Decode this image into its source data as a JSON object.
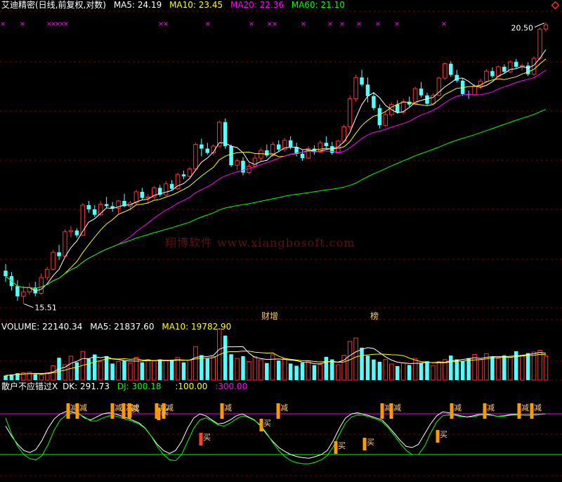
{
  "price_panel": {
    "title": "艾迪精密(日线,前复权,对数)",
    "ma_labels": [
      {
        "text": "MA5: 24.19",
        "color": "#ffffff"
      },
      {
        "text": "MA10: 23.45",
        "color": "#ffff00"
      },
      {
        "text": "MA20: 22.36",
        "color": "#ff00ff"
      },
      {
        "text": "MA60: 21.10",
        "color": "#00ff00"
      }
    ],
    "high_label": "20.50",
    "low_label": "15.51",
    "event_labels": [
      "财增",
      "榜"
    ],
    "watermark": "翔博软件 www.xiangbosoft.com"
  },
  "volume_panel": {
    "labels": [
      {
        "text": "VOLUME: 22140.34",
        "color": "#ffffff"
      },
      {
        "text": "MA5: 21837.60",
        "color": "#ffffff"
      },
      {
        "text": "MA10: 19782.90",
        "color": "#ffff00"
      }
    ]
  },
  "indicator_panel": {
    "labels": [
      {
        "text": "散户不应错过X",
        "color": "#ffffff"
      },
      {
        "text": "DK: 291.73",
        "color": "#ffffff"
      },
      {
        "text": "DJ: 300.18",
        "color": "#00ff00"
      },
      {
        "text": ":100.00",
        "color": "#ffff00"
      },
      {
        "text": ":300.00",
        "color": "#ff00ff"
      }
    ],
    "sell_label": "减",
    "buy_label": "买"
  },
  "colors": {
    "up": "#ff3232",
    "down": "#54ffff",
    "ma5": "#ffffff",
    "ma10": "#ffff00",
    "ma20": "#ff00ff",
    "ma60": "#00ff00",
    "grid": "#7a0000",
    "marker": "#ff00ff",
    "signal": "#ff9900"
  },
  "chart_data": [
    {
      "type": "candlestick",
      "series_order": [
        "open",
        "high",
        "low",
        "close"
      ],
      "candles": [
        [
          19.0,
          19.5,
          18.2,
          18.6
        ],
        [
          18.6,
          18.9,
          17.6,
          17.9
        ],
        [
          17.9,
          18.3,
          16.9,
          17.2
        ],
        [
          17.2,
          17.9,
          16.7,
          17.5
        ],
        [
          17.5,
          18.1,
          17.3,
          17.8
        ],
        [
          17.8,
          18.2,
          17.2,
          17.4
        ],
        [
          17.4,
          18.8,
          17.3,
          18.5
        ],
        [
          18.5,
          19.3,
          18.3,
          19.1
        ],
        [
          19.1,
          20.6,
          19.0,
          20.4
        ],
        [
          20.4,
          21.0,
          19.8,
          20.1
        ],
        [
          20.1,
          22.3,
          20.0,
          22.1
        ],
        [
          22.1,
          22.6,
          21.6,
          22.2
        ],
        [
          22.2,
          22.4,
          21.6,
          21.8
        ],
        [
          21.8,
          24.7,
          21.7,
          24.5
        ],
        [
          24.5,
          24.9,
          23.8,
          24.1
        ],
        [
          24.1,
          24.5,
          23.4,
          23.6
        ],
        [
          23.6,
          24.9,
          23.5,
          24.6
        ],
        [
          24.6,
          25.3,
          24.2,
          24.4
        ],
        [
          24.4,
          24.8,
          23.9,
          24.2
        ],
        [
          24.2,
          25.0,
          23.7,
          24.9
        ],
        [
          24.9,
          25.6,
          24.3,
          24.4
        ],
        [
          24.4,
          24.9,
          24.0,
          24.7
        ],
        [
          24.7,
          26.0,
          24.5,
          25.8
        ],
        [
          25.8,
          26.2,
          25.0,
          25.2
        ],
        [
          25.2,
          25.6,
          24.6,
          25.3
        ],
        [
          25.3,
          26.4,
          25.1,
          26.2
        ],
        [
          26.2,
          26.5,
          25.3,
          25.5
        ],
        [
          25.5,
          26.9,
          25.4,
          26.6
        ],
        [
          26.6,
          27.0,
          25.9,
          26.1
        ],
        [
          26.1,
          27.8,
          26.0,
          27.6
        ],
        [
          27.6,
          28.0,
          27.1,
          27.4
        ],
        [
          27.4,
          28.4,
          27.3,
          28.2
        ],
        [
          28.2,
          31.2,
          28.0,
          31.0
        ],
        [
          31.0,
          31.7,
          29.6,
          30.5
        ],
        [
          30.5,
          31.2,
          29.8,
          30.0
        ],
        [
          30.0,
          31.0,
          29.7,
          30.8
        ],
        [
          30.8,
          34.0,
          30.6,
          33.8
        ],
        [
          33.8,
          34.3,
          30.5,
          30.8
        ],
        [
          30.8,
          31.0,
          28.4,
          28.6
        ],
        [
          28.6,
          29.3,
          28.1,
          29.1
        ],
        [
          29.1,
          29.5,
          27.5,
          27.8
        ],
        [
          27.8,
          28.8,
          27.6,
          28.5
        ],
        [
          28.5,
          29.8,
          28.3,
          29.4
        ],
        [
          29.4,
          30.6,
          29.0,
          30.3
        ],
        [
          30.3,
          31.0,
          29.5,
          29.7
        ],
        [
          29.7,
          31.3,
          29.5,
          31.0
        ],
        [
          31.0,
          31.5,
          30.2,
          30.4
        ],
        [
          30.4,
          31.8,
          30.1,
          31.5
        ],
        [
          31.5,
          32.0,
          30.4,
          30.7
        ],
        [
          30.7,
          31.2,
          29.6,
          29.9
        ],
        [
          29.9,
          30.3,
          29.1,
          29.4
        ],
        [
          29.4,
          30.8,
          29.3,
          30.5
        ],
        [
          30.5,
          30.9,
          29.8,
          30.1
        ],
        [
          30.1,
          31.5,
          30.0,
          31.2
        ],
        [
          31.2,
          32.0,
          30.5,
          30.8
        ],
        [
          30.8,
          31.3,
          29.8,
          30.0
        ],
        [
          30.0,
          31.6,
          29.9,
          31.4
        ],
        [
          31.4,
          33.5,
          31.2,
          33.2
        ],
        [
          33.2,
          37.5,
          32.8,
          37.0
        ],
        [
          37.0,
          40.6,
          36.6,
          40.2
        ],
        [
          40.2,
          41.4,
          38.8,
          39.1
        ],
        [
          39.1,
          40.2,
          36.5,
          37.4
        ],
        [
          37.4,
          38.0,
          35.4,
          35.7
        ],
        [
          35.7,
          36.2,
          33.0,
          33.4
        ],
        [
          33.4,
          35.1,
          33.2,
          34.8
        ],
        [
          34.8,
          36.5,
          34.5,
          36.2
        ],
        [
          36.2,
          36.8,
          34.9,
          35.1
        ],
        [
          35.1,
          37.0,
          34.9,
          36.6
        ],
        [
          36.6,
          37.3,
          35.9,
          36.2
        ],
        [
          36.2,
          38.8,
          36.1,
          38.5
        ],
        [
          38.5,
          39.5,
          37.2,
          37.5
        ],
        [
          37.5,
          37.9,
          36.1,
          36.3
        ],
        [
          36.3,
          37.8,
          36.2,
          37.5
        ],
        [
          37.5,
          40.3,
          37.4,
          40.1
        ],
        [
          40.1,
          42.6,
          39.8,
          42.4
        ],
        [
          42.4,
          42.8,
          40.3,
          40.6
        ],
        [
          40.6,
          41.4,
          39.4,
          39.7
        ],
        [
          39.7,
          40.0,
          37.4,
          37.7
        ],
        [
          37.7,
          38.2,
          37.0,
          37.6
        ],
        [
          37.6,
          39.2,
          37.4,
          38.9
        ],
        [
          38.9,
          40.0,
          38.4,
          39.6
        ],
        [
          39.6,
          41.5,
          39.4,
          41.2
        ],
        [
          41.2,
          41.8,
          40.1,
          40.4
        ],
        [
          40.4,
          42.1,
          40.2,
          41.9
        ],
        [
          41.9,
          42.3,
          40.8,
          41.1
        ],
        [
          41.1,
          43.0,
          40.9,
          42.7
        ],
        [
          42.7,
          43.2,
          41.6,
          41.9
        ],
        [
          41.9,
          42.4,
          41.3,
          42.1
        ],
        [
          42.1,
          42.6,
          40.4,
          40.7
        ],
        [
          40.7,
          43.6,
          40.5,
          43.3
        ],
        [
          43.3,
          48.8,
          43.0,
          48.5
        ],
        [
          48.5,
          49.8,
          48.0,
          49.3
        ]
      ]
    },
    {
      "type": "bar",
      "name": "VOLUME",
      "values": [
        4200,
        5100,
        6300,
        6800,
        7200,
        5300,
        4800,
        6900,
        13200,
        20400,
        14100,
        21800,
        16300,
        26200,
        19400,
        23400,
        16800,
        21900,
        15100,
        17200,
        17700,
        15600,
        20800,
        16200,
        18800,
        17400,
        18900,
        18300,
        17800,
        20600,
        16100,
        18300,
        30600,
        22800,
        19600,
        21400,
        46800,
        40600,
        23600,
        19800,
        21900,
        16900,
        21400,
        18600,
        15600,
        23100,
        17800,
        19600,
        15100,
        13100,
        15800,
        17200,
        13700,
        14300,
        21200,
        18900,
        14100,
        22600,
        35300,
        38400,
        29600,
        22300,
        18800,
        16700,
        18800,
        14700,
        12800,
        15600,
        13800,
        19800,
        15400,
        17200,
        13400,
        16800,
        18700,
        22400,
        18900,
        17600,
        20100,
        23400,
        18600,
        24100,
        21300,
        19800,
        22600,
        20900,
        26400,
        22700,
        24600,
        25600,
        27200,
        22100
      ]
    },
    {
      "type": "line",
      "name": "散户不应错过X",
      "ylim": [
        0,
        400
      ],
      "reference_lines": [
        100,
        300
      ],
      "sell_signals": [
        22,
        27,
        38,
        54,
        70,
        73,
        85,
        88,
        100,
        118,
        130,
        153,
        167,
        173,
        182,
        188
      ],
      "buy_signals": [
        70,
        140,
        183,
        240,
        253,
        308
      ],
      "series": [
        {
          "name": "DK",
          "values": [
            240,
            190,
            150,
            120,
            110,
            125,
            170,
            230,
            275,
            300,
            312,
            310,
            302,
            280,
            270,
            285,
            300,
            305,
            300,
            290,
            280,
            268,
            255,
            230,
            190,
            150,
            120,
            105,
            120,
            165,
            230,
            280,
            300,
            290,
            270,
            250,
            255,
            270,
            290,
            300,
            285,
            270,
            240,
            200,
            165,
            135,
            115,
            100,
            90,
            85,
            82,
            90,
            100,
            120,
            170,
            230,
            280,
            300,
            305,
            298,
            290,
            280,
            270,
            240,
            205,
            170,
            140,
            135,
            150,
            200,
            250,
            290,
            310,
            305,
            298,
            290,
            285,
            290,
            298,
            300,
            295,
            288,
            290,
            296,
            298,
            295,
            294,
            296,
            298,
            300
          ]
        },
        {
          "name": "DJ",
          "values": [
            280,
            200,
            140,
            100,
            80,
            75,
            95,
            150,
            220,
            270,
            295,
            305,
            300,
            285,
            265,
            265,
            280,
            290,
            290,
            282,
            272,
            262,
            250,
            228,
            190,
            140,
            100,
            75,
            70,
            100,
            165,
            230,
            270,
            280,
            265,
            245,
            240,
            255,
            275,
            290,
            282,
            268,
            245,
            205,
            160,
            120,
            90,
            70,
            60,
            55,
            55,
            62,
            75,
            95,
            140,
            200,
            255,
            285,
            295,
            292,
            285,
            275,
            262,
            232,
            195,
            155,
            120,
            100,
            100,
            140,
            205,
            260,
            290,
            295,
            292,
            287,
            283,
            286,
            292,
            295,
            293,
            288,
            288,
            292,
            296,
            294,
            293,
            295,
            297,
            300
          ]
        }
      ]
    }
  ]
}
